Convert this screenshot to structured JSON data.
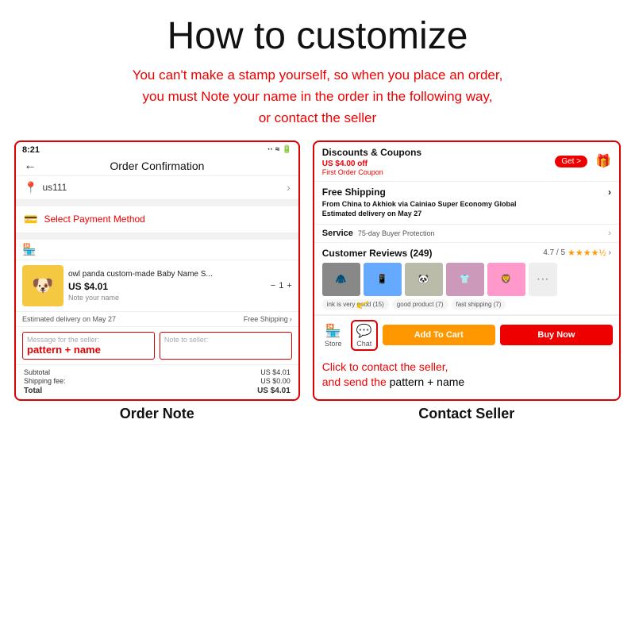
{
  "page": {
    "title": "How to customize",
    "subtitle_line1": "You can't make a stamp yourself, so when you place an order,",
    "subtitle_line2": "you must Note your name in the order in the following way,",
    "subtitle_line3": "or contact the seller"
  },
  "left_panel": {
    "status_time": "8:21",
    "status_icons": "·· ≈ 🔋",
    "header_title": "Order Confirmation",
    "back_label": "←",
    "address_icon": "📍",
    "address": "us111",
    "chevron": ">",
    "payment_label": "Select Payment Method",
    "product_emoji": "🐶",
    "product_name": "owl panda custom-made Baby Name S...",
    "product_price": "US $4.01",
    "note_label": "Note your name",
    "qty": "1",
    "delivery": "Estimated delivery on May 27",
    "shipping": "Free Shipping",
    "msg_seller_label": "Message for the seller:",
    "note_seller_label": "Note to seller:",
    "pattern_name_text": "pattern + name",
    "subtotal_label": "Subtotal",
    "subtotal_value": "US $4.01",
    "shipping_fee_label": "Shipping fee:",
    "shipping_fee_value": "US $0.00",
    "total_label": "Total",
    "total_value": "US $4.01",
    "panel_label": "Order Note"
  },
  "right_panel": {
    "discount_title": "Discounts & Coupons",
    "get_btn": "Get >",
    "discount_offer": "US $4.00 off",
    "discount_label": "First Order Coupon",
    "coupon_emoji": "🎁",
    "shipping_title": "Free Shipping",
    "shipping_chevron": ">",
    "shipping_line1": "From China to Akhiok via Cainiao Super Economy Global",
    "shipping_line2": "Estimated delivery on May 27",
    "service_label": "Service",
    "service_value": "75-day Buyer Protection",
    "service_chevron": ">",
    "reviews_title": "Customer Reviews (249)",
    "reviews_rating": "4.7 / 5",
    "reviews_chevron": ">",
    "review_tags": [
      "ink is very good (15)",
      "good product (7)",
      "fast shipping (7)"
    ],
    "store_label": "Store",
    "chat_label": "Chat",
    "add_cart_label": "Add To Cart",
    "buy_now_label": "Buy Now",
    "click_text_line1": "Click to contact the seller,",
    "click_text_line2": "and send the  pattern + name",
    "panel_label": "Contact Seller"
  }
}
